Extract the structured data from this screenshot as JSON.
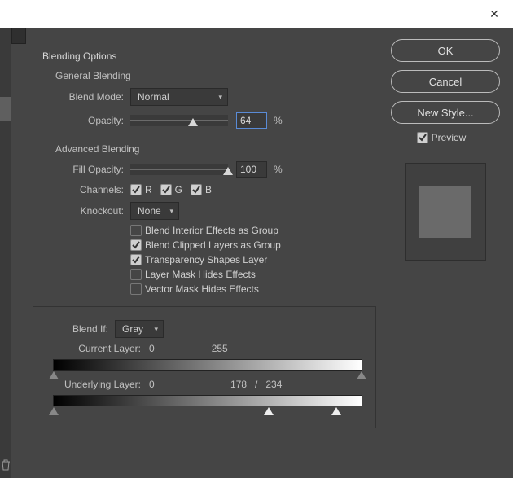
{
  "titlebar": {
    "close_glyph": "✕"
  },
  "section": {
    "title": "Blending Options"
  },
  "general": {
    "title": "General Blending",
    "blend_mode_label": "Blend Mode:",
    "blend_mode_value": "Normal",
    "opacity_label": "Opacity:",
    "opacity_value": "64",
    "opacity_pct": 64,
    "percent": "%"
  },
  "advanced": {
    "title": "Advanced Blending",
    "fill_opacity_label": "Fill Opacity:",
    "fill_opacity_value": "100",
    "fill_opacity_pct": 100,
    "percent": "%",
    "channels_label": "Channels:",
    "channels": {
      "r": "R",
      "g": "G",
      "b": "B"
    },
    "knockout_label": "Knockout:",
    "knockout_value": "None",
    "opts": {
      "interior": "Blend Interior Effects as Group",
      "clipped": "Blend Clipped Layers as Group",
      "transparency": "Transparency Shapes Layer",
      "layermask": "Layer Mask Hides Effects",
      "vectormask": "Vector Mask Hides Effects"
    },
    "opts_checked": {
      "interior": false,
      "clipped": true,
      "transparency": true,
      "layermask": false,
      "vectormask": false
    }
  },
  "blendif": {
    "label": "Blend If:",
    "channel": "Gray",
    "current_label": "Current Layer:",
    "current_lo": "0",
    "current_hi": "255",
    "under_label": "Underlying Layer:",
    "under_lo": "0",
    "under_hi_a": "178",
    "slash": "/",
    "under_hi_b": "234"
  },
  "buttons": {
    "ok": "OK",
    "cancel": "Cancel",
    "new_style": "New Style..."
  },
  "preview": {
    "label": "Preview"
  },
  "colors": {
    "accent_border": "#5a8bd6",
    "swatch": "#6a6a6a"
  }
}
